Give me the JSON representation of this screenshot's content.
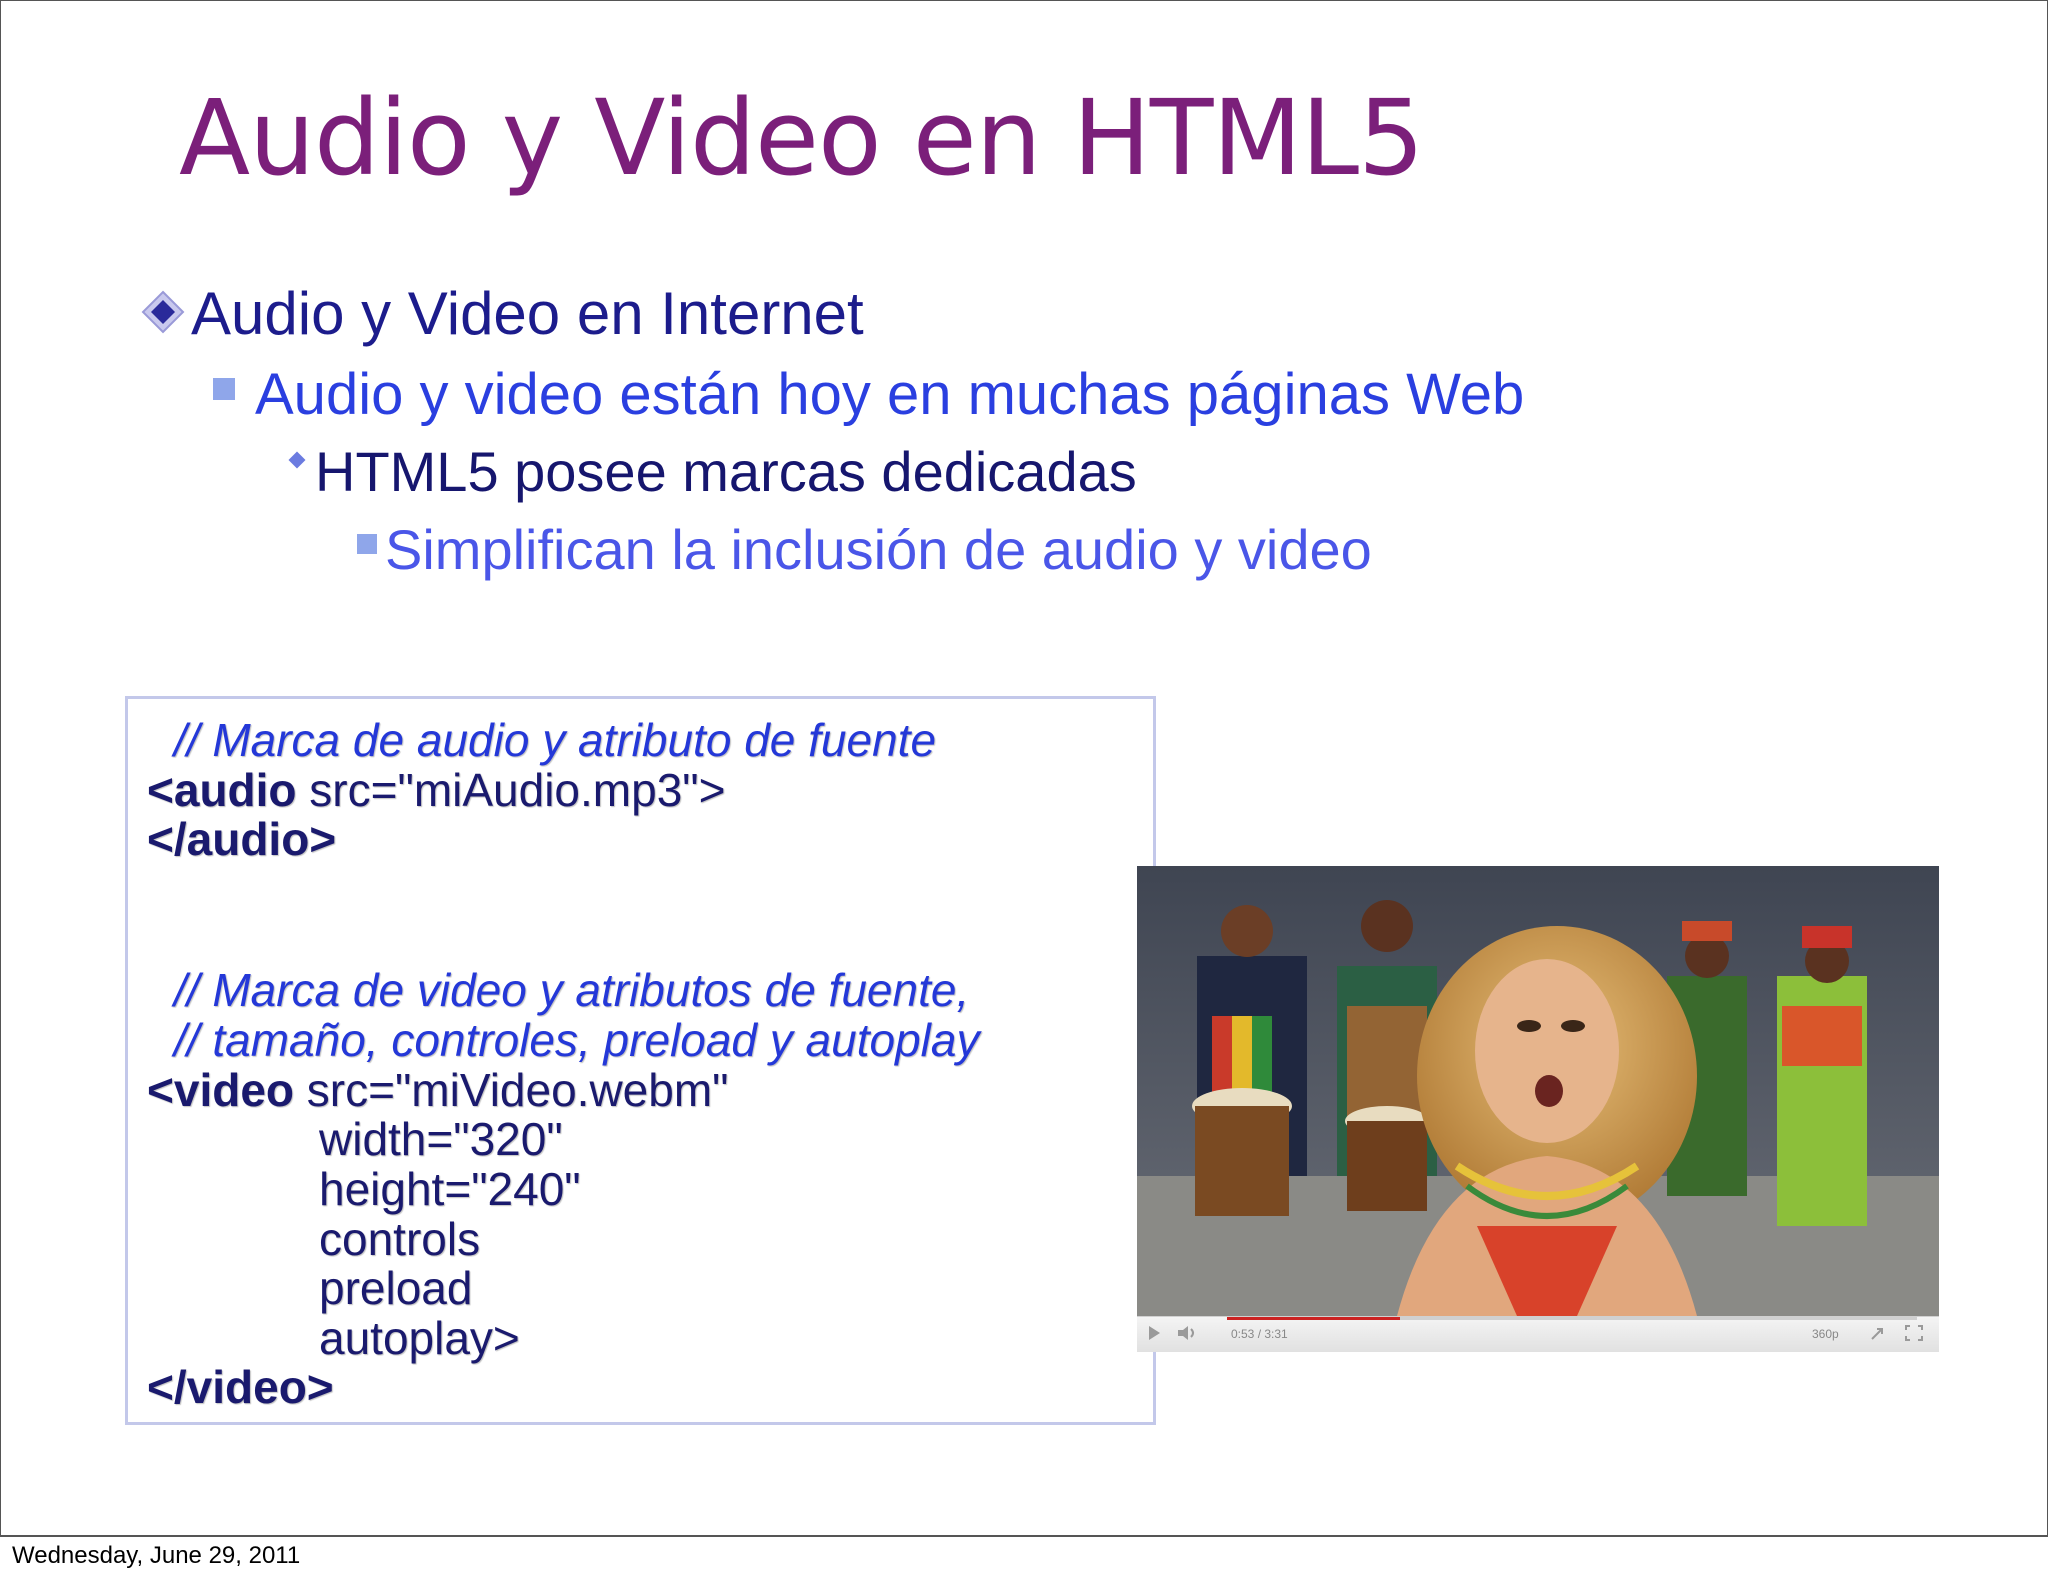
{
  "slide": {
    "title": "Audio y Video en HTML5",
    "bullets": {
      "level1": "Audio y Video en Internet",
      "level2": "Audio y video están hoy en muchas páginas Web",
      "level3": "HTML5 posee marcas dedicadas",
      "level4": "Simplifican la inclusión de audio y video"
    },
    "code": {
      "comment_audio": "// Marca de audio y atributo de fuente",
      "audio_open_tag": "<audio",
      "audio_src": " src=\"miAudio.mp3\">",
      "audio_close": "</audio>",
      "comment_video_1": "// Marca de video y atributos de fuente,",
      "comment_video_2": "//  tamaño, controles, preload y autoplay",
      "video_open_tag": "<video",
      "video_src": " src=\"miVideo.webm\"",
      "video_width": "width=\"320\"",
      "video_height": "height=\"240\"",
      "video_controls": "controls",
      "video_preload": "preload",
      "video_autoplay": "autoplay>",
      "video_close": "</video>"
    },
    "video_player": {
      "time": "0:53 / 3:31",
      "quality": "360p",
      "progress_fraction": 0.25
    },
    "colors": {
      "title": "#7b1f7a",
      "level1": "#1c1c8c",
      "level2": "#2a3fe0",
      "level4": "#4a56e8"
    }
  },
  "footer": {
    "date": "Wednesday, June 29, 2011"
  }
}
